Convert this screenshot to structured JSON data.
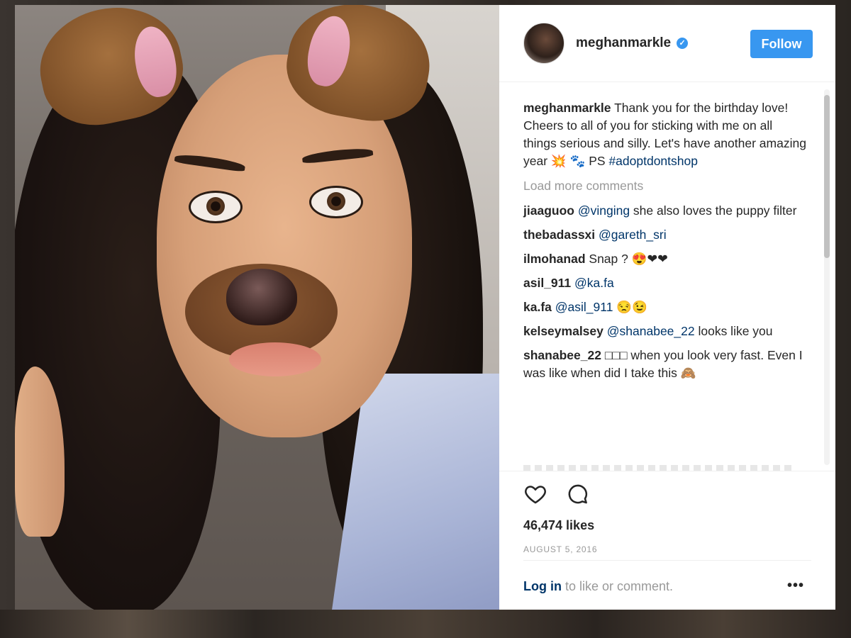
{
  "post": {
    "username": "meghanmarkle",
    "verified": true,
    "follow_label": "Follow",
    "caption_user": "meghanmarkle",
    "caption_text": "Thank you for the birthday love! Cheers to all of you for sticking with me on all things serious and silly. Let's have another amazing year 💥",
    "caption_text2": "🐾 PS ",
    "caption_hashtag": "#adoptdontshop",
    "load_more": "Load more comments",
    "likes": "46,474 likes",
    "date": "AUGUST 5, 2016",
    "login_link": "Log in",
    "login_text": " to like or comment.",
    "more_label": "•••"
  },
  "comments": [
    {
      "user": "jiaaguoo",
      "mention": "@vinging",
      "text": " she also loves the puppy filter"
    },
    {
      "user": "thebadassxi",
      "mention": "@gareth_sri",
      "text": ""
    },
    {
      "user": "ilmohanad",
      "mention": "",
      "text": "Snap ? 😍❤❤"
    },
    {
      "user": "asil_911",
      "mention": "@ka.fa",
      "text": ""
    },
    {
      "user": "ka.fa",
      "mention": "@asil_911",
      "text": " 😒😉"
    },
    {
      "user": "kelseymalsey",
      "mention": "@shanabee_22",
      "text": " looks like you"
    },
    {
      "user": "shanabee_22",
      "mention": "",
      "text": "□□□ when you look very fast. Even I was like when did I take this 🙈"
    }
  ],
  "icons": {
    "heart": "heart-icon",
    "comment": "comment-icon",
    "verified": "verified-badge-icon"
  },
  "colors": {
    "accent": "#3897f0",
    "link": "#003569",
    "muted": "#999999",
    "text": "#262626"
  }
}
